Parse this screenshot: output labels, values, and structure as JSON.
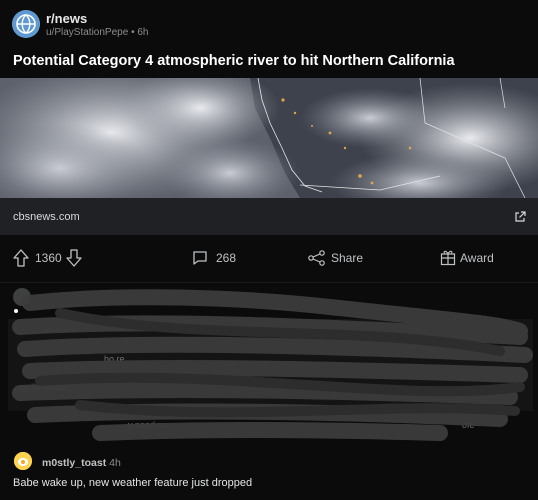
{
  "post": {
    "subreddit": "r/news",
    "author": "u/PlayStationPepe",
    "age": "6h",
    "title": "Potential Category 4 atmospheric river to hit Northern California",
    "domain": "cbsnews.com"
  },
  "actions": {
    "upvotes": "1360",
    "comments": "268",
    "share": "Share",
    "award": "Award"
  },
  "top_comment": {
    "author": "m0stly_toast",
    "age": "4h",
    "text": "Babe wake up, new weather feature just dropped"
  },
  "blurred_comment": {
    "visible_fragments": [
      "ho re",
      "...op/produce",
      "y need ru",
      "ofe"
    ]
  },
  "colors": {
    "background": "#0b0b0b",
    "linkbar": "#202124",
    "text": "#d7dadc"
  }
}
